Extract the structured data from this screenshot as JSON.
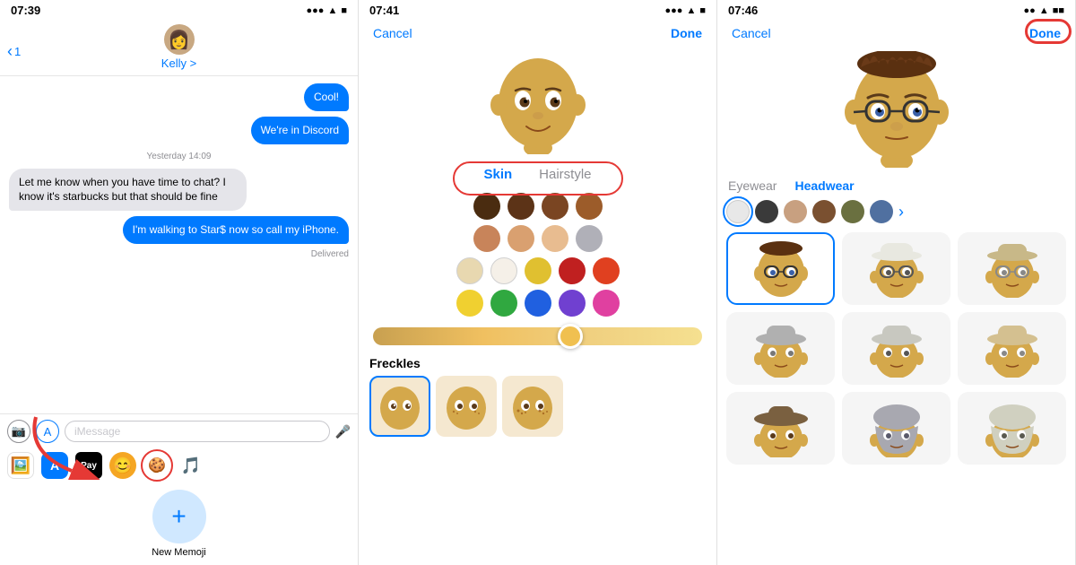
{
  "panel1": {
    "time": "07:39",
    "signal": "●●● ▲ ■",
    "back_label": "1",
    "contact_name": "Kelly >",
    "messages": [
      {
        "type": "out",
        "text": "Cool!"
      },
      {
        "type": "out",
        "text": "We're in Discord"
      },
      {
        "type": "timestamp",
        "text": "Yesterday 14:09"
      },
      {
        "type": "in",
        "text": "Let me know when you have time to chat? I know it's starbucks but that should be fine"
      },
      {
        "type": "out",
        "text": "I'm walking to Star$ now so call my iPhone."
      },
      {
        "type": "status",
        "text": "Delivered"
      }
    ],
    "input_placeholder": "iMessage",
    "new_memoji_label": "New Memoji"
  },
  "panel2": {
    "time": "07:41",
    "cancel_label": "Cancel",
    "done_label": "Done",
    "tabs": [
      {
        "label": "Skin",
        "active": true
      },
      {
        "label": "Hairstyle",
        "active": false
      }
    ],
    "skin_colors_row1": [
      "#4a2c10",
      "#5c3317",
      "#7a4522",
      "#9c5c2a"
    ],
    "skin_colors_row2": [
      "#c8845a",
      "#d9a070",
      "#e8bc90",
      "#c0c0c0"
    ],
    "skin_colors_row3": [
      "#e0c8a0",
      "#f5f0e8",
      "#e8c040",
      "#c03030",
      "#e05020"
    ],
    "skin_colors_row4": [
      "#f0d030",
      "#40b040",
      "#3060e0",
      "#7040d0",
      "#e040a0"
    ],
    "freckles_label": "Freckles"
  },
  "panel3": {
    "time": "07:46",
    "cancel_label": "Cancel",
    "done_label": "Done",
    "tabs": [
      {
        "label": "Eyewear",
        "active": false
      },
      {
        "label": "Headwear",
        "active": true
      }
    ],
    "eyewear_colors": [
      "#e8e8e8",
      "#3a3a3a",
      "#c8a080",
      "#7a5030",
      "#6a7040",
      "#5070a0"
    ],
    "headwear_items": [
      {
        "selected": true,
        "emoji": "🧑"
      },
      {
        "selected": false,
        "emoji": "🧑"
      },
      {
        "selected": false,
        "emoji": "🧑"
      },
      {
        "selected": false,
        "emoji": "🧑"
      },
      {
        "selected": false,
        "emoji": "🧑"
      },
      {
        "selected": false,
        "emoji": "🧑"
      },
      {
        "selected": false,
        "emoji": "🧑"
      },
      {
        "selected": false,
        "emoji": "🧑"
      },
      {
        "selected": false,
        "emoji": "🧑"
      }
    ]
  }
}
